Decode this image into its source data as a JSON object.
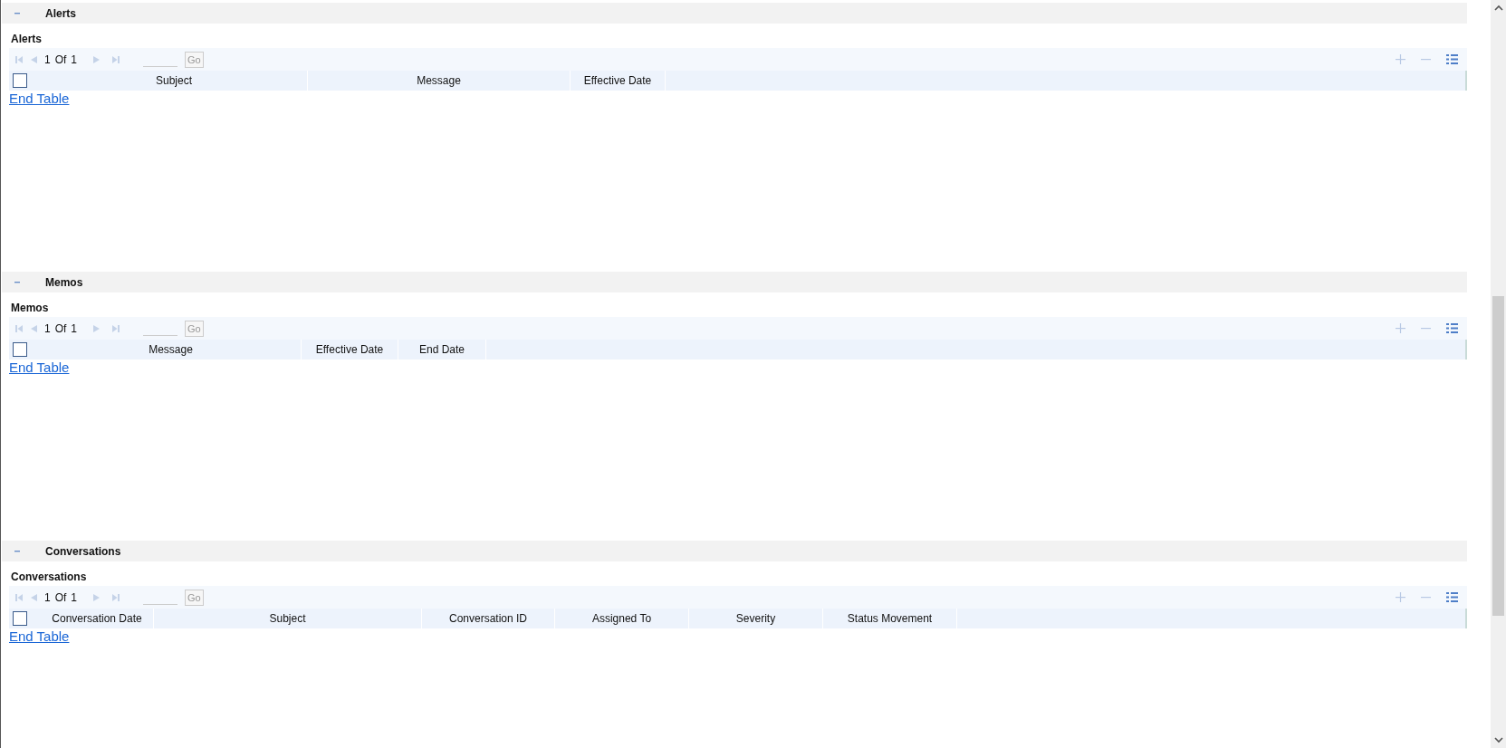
{
  "sections": [
    {
      "header": "Alerts",
      "expanded": true,
      "title": "Alerts",
      "pager": {
        "page": "1",
        "of": "Of",
        "total": "1"
      },
      "go": "Go",
      "select_all_checked": false,
      "columns": [
        "Subject",
        "Message",
        "Effective Date"
      ],
      "end_link": "End Table"
    },
    {
      "header": "Memos",
      "expanded": true,
      "title": "Memos",
      "pager": {
        "page": "1",
        "of": "Of",
        "total": "1"
      },
      "go": "Go",
      "select_all_checked": false,
      "columns": [
        "Message",
        "Effective Date",
        "End Date"
      ],
      "end_link": "End Table"
    },
    {
      "header": "Conversations",
      "expanded": true,
      "title": "Conversations",
      "pager": {
        "page": "1",
        "of": "Of",
        "total": "1"
      },
      "go": "Go",
      "select_all_checked": false,
      "columns": [
        "Conversation Date",
        "Subject",
        "Conversation ID",
        "Assigned To",
        "Severity",
        "Status Movement"
      ],
      "end_link": "End Table"
    }
  ]
}
